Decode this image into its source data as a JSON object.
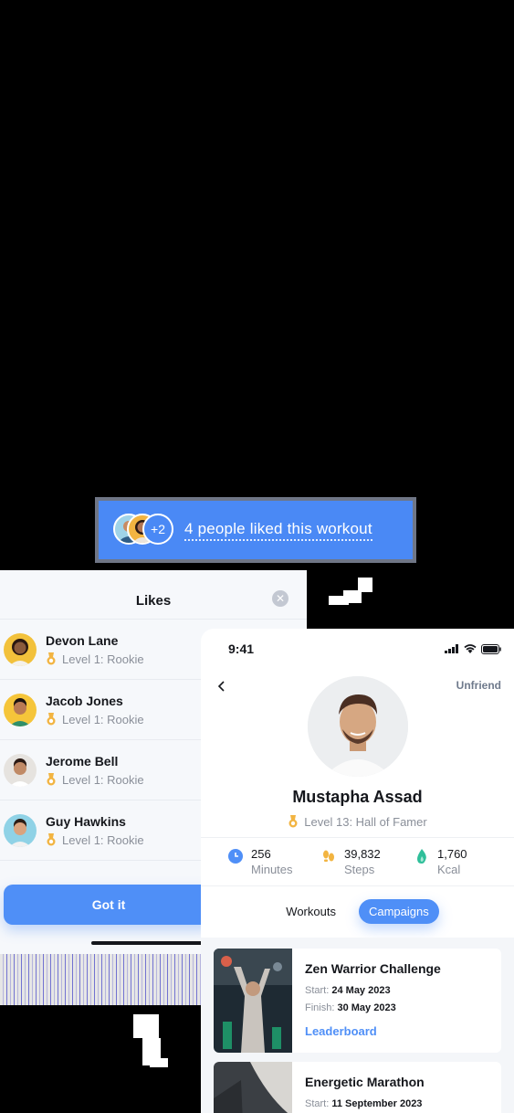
{
  "banner": {
    "more_count": "+2",
    "text": "4 people liked this workout"
  },
  "likes_sheet": {
    "title": "Likes",
    "close_icon": "close-icon",
    "users": [
      {
        "name": "Devon Lane",
        "level": "Level 1: Rookie",
        "avatar_color": "#f2c13b"
      },
      {
        "name": "Jacob Jones",
        "level": "Level 1: Rookie",
        "avatar_color": "#f5c53a"
      },
      {
        "name": "Jerome Bell",
        "level": "Level 1: Rookie",
        "avatar_color": "#e6e3df"
      },
      {
        "name": "Guy Hawkins",
        "level": "Level 1: Rookie",
        "avatar_color": "#8fd2e6"
      }
    ],
    "button_label": "Got it"
  },
  "profile": {
    "status_time": "9:41",
    "unfriend_label": "Unfriend",
    "name": "Mustapha Assad",
    "level": "Level 13: Hall of Famer",
    "stats": [
      {
        "value": "256",
        "label": "Minutes",
        "icon": "clock-icon"
      },
      {
        "value": "39,832",
        "label": "Steps",
        "icon": "footsteps-icon"
      },
      {
        "value": "1,760",
        "label": "Kcal",
        "icon": "flame-icon"
      }
    ],
    "tabs": [
      {
        "label": "Workouts",
        "active": false
      },
      {
        "label": "Campaigns",
        "active": true
      }
    ],
    "campaigns": [
      {
        "title": "Zen Warrior Challenge",
        "start_label": "Start:",
        "start": "24 May 2023",
        "finish_label": "Finish:",
        "finish": "30 May 2023",
        "link": "Leaderboard"
      },
      {
        "title": "Energetic Marathon",
        "start_label": "Start:",
        "start": "11 September 2023"
      }
    ]
  },
  "colors": {
    "accent": "#4f8ff7",
    "banner": "#4a89f5",
    "medal": "#f2b441"
  }
}
